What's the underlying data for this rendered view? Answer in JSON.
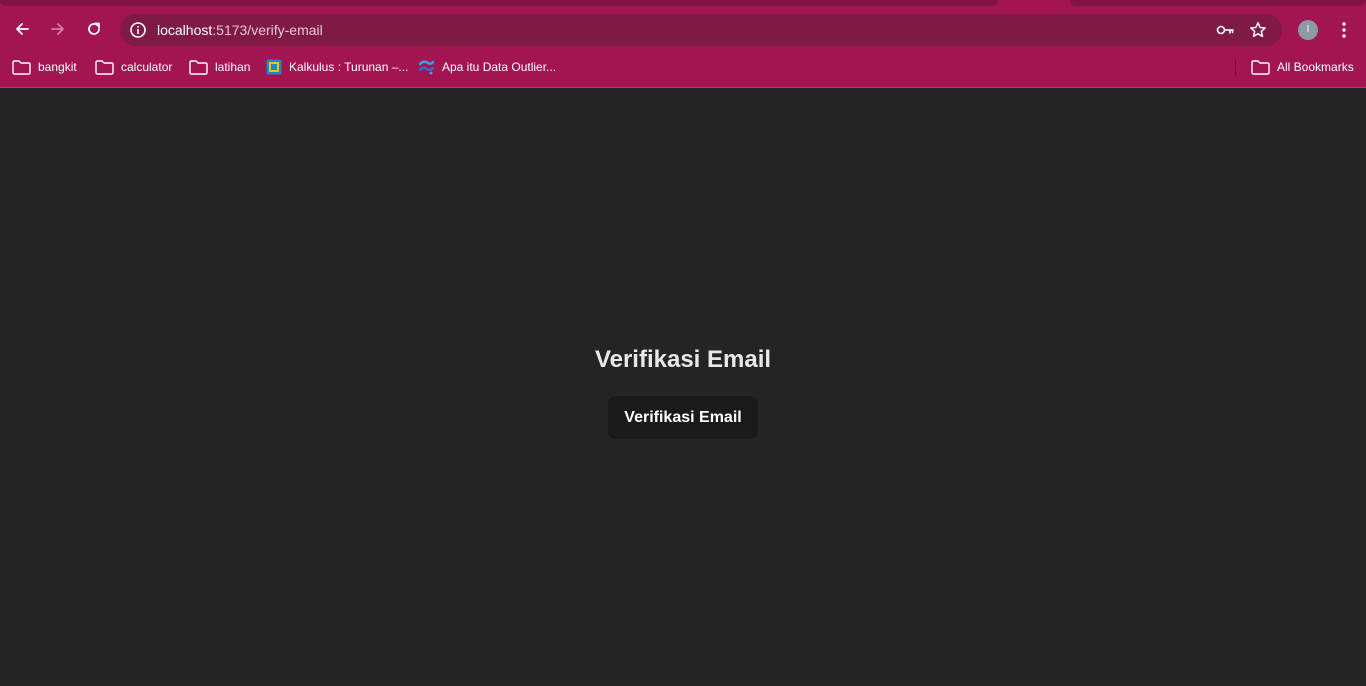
{
  "browser": {
    "url_host": "localhost",
    "url_path": ":5173/verify-email",
    "profile_initial": "I",
    "theme_color": "#a31550",
    "omnibox_color": "#7f1a44"
  },
  "bookmarks": {
    "items": [
      {
        "label": "bangkit",
        "icon": "folder-icon"
      },
      {
        "label": "calculator",
        "icon": "folder-icon"
      },
      {
        "label": "latihan",
        "icon": "folder-icon"
      },
      {
        "label": "Kalkulus : Turunan –...",
        "icon": "site-icon"
      },
      {
        "label": "Apa itu Data Outlier...",
        "icon": "site-icon"
      }
    ],
    "all_bookmarks_label": "All Bookmarks"
  },
  "page": {
    "heading": "Verifikasi Email",
    "button_label": "Verifikasi Email",
    "background_color": "#242424",
    "button_color": "#1a1a1a"
  }
}
